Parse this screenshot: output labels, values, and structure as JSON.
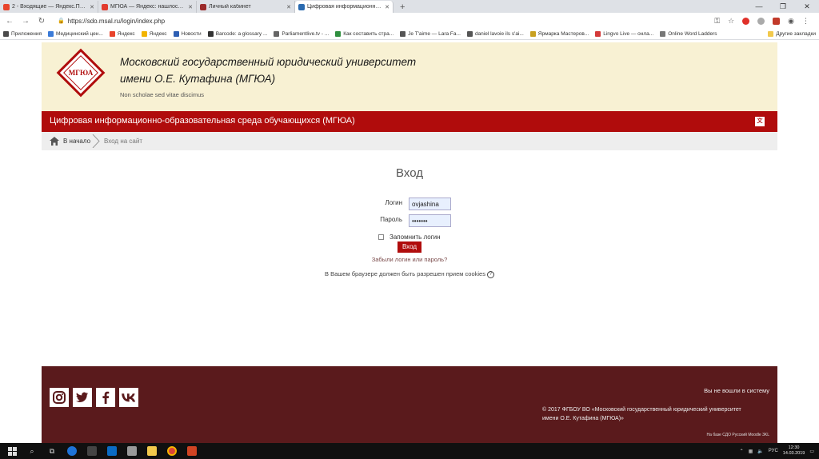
{
  "browser": {
    "tabs": [
      {
        "label": "2 - Входящие — Яндекс.Почта",
        "color": "#e8442c"
      },
      {
        "label": "МГЮА — Яндекс: нашлось 404...",
        "color": "#e23b2e"
      },
      {
        "label": "Личный кабинет",
        "color": "#9b2a2a"
      },
      {
        "label": "Цифровая информационно-об...",
        "color": "#2a6ab0",
        "active": true
      }
    ],
    "new_tab": "+",
    "url": "https://sdo.msal.ru/login/index.php",
    "bookmarks": [
      {
        "label": "Приложения",
        "color": "#4a4a4a"
      },
      {
        "label": "Медицинский цен...",
        "color": "#3b7bd8"
      },
      {
        "label": "Яндекс",
        "color": "#e8442c"
      },
      {
        "label": "Яндекс",
        "color": "#f2b400"
      },
      {
        "label": "Новости",
        "color": "#2d5fb4"
      },
      {
        "label": "Barcode: a glossary ...",
        "color": "#333333"
      },
      {
        "label": "Parliamentlive.tv - ...",
        "color": "#666666"
      },
      {
        "label": "Как составить стра...",
        "color": "#2f8f3f"
      },
      {
        "label": "Je T'aime — Lara Fa...",
        "color": "#555555"
      },
      {
        "label": "daniel lavoie ils s'ai...",
        "color": "#555555"
      },
      {
        "label": "Ярмарка Мастеров...",
        "color": "#c8a020"
      },
      {
        "label": "Lingvo Live — онла...",
        "color": "#d43a3a"
      },
      {
        "label": "Online Word Ladders",
        "color": "#777777"
      }
    ],
    "bookmarks_other": "Другие закладки"
  },
  "header": {
    "university_line1": "Московский государственный юридический университет",
    "university_line2": "имени О.Е. Кутафина (МГЮА)",
    "logo_text": "МГЮА",
    "motto": "Non scholae sed vitae discimus"
  },
  "navbar": {
    "title": "Цифровая информационно-образовательная среда обучающихся (МГЮА)",
    "lang_icon": "文A"
  },
  "breadcrumb": {
    "home": "В начало",
    "current": "Вход на сайт"
  },
  "login": {
    "title": "Вход",
    "username_label": "Логин",
    "username_value": "ovjashina",
    "password_label": "Пароль",
    "password_value": "•••••••",
    "remember_label": "Запомнить логин",
    "submit_label": "Вход",
    "forgot_link": "Забыли логин или пароль?",
    "cookies_note": "В Вашем браузере должен быть разрешен прием cookies"
  },
  "footer": {
    "not_logged": "Вы не вошли в систему",
    "copyright_line1": "© 2017 ФГБОУ ВО «Московский государственный юридический университет",
    "copyright_line2": "имени О.Е. Кутафина (МГЮА)»",
    "moodle": "На базе СДО Русский Moodle 3KL",
    "social_icons": [
      "instagram-icon",
      "twitter-icon",
      "facebook-icon",
      "vk-icon"
    ]
  },
  "taskbar": {
    "lang": "РУС",
    "time": "12:30",
    "date": "14.03.2019"
  },
  "colors": {
    "brand_red": "#b00c0c",
    "header_bg": "#f8f1d3",
    "footer_bg": "#5a1a1c"
  }
}
